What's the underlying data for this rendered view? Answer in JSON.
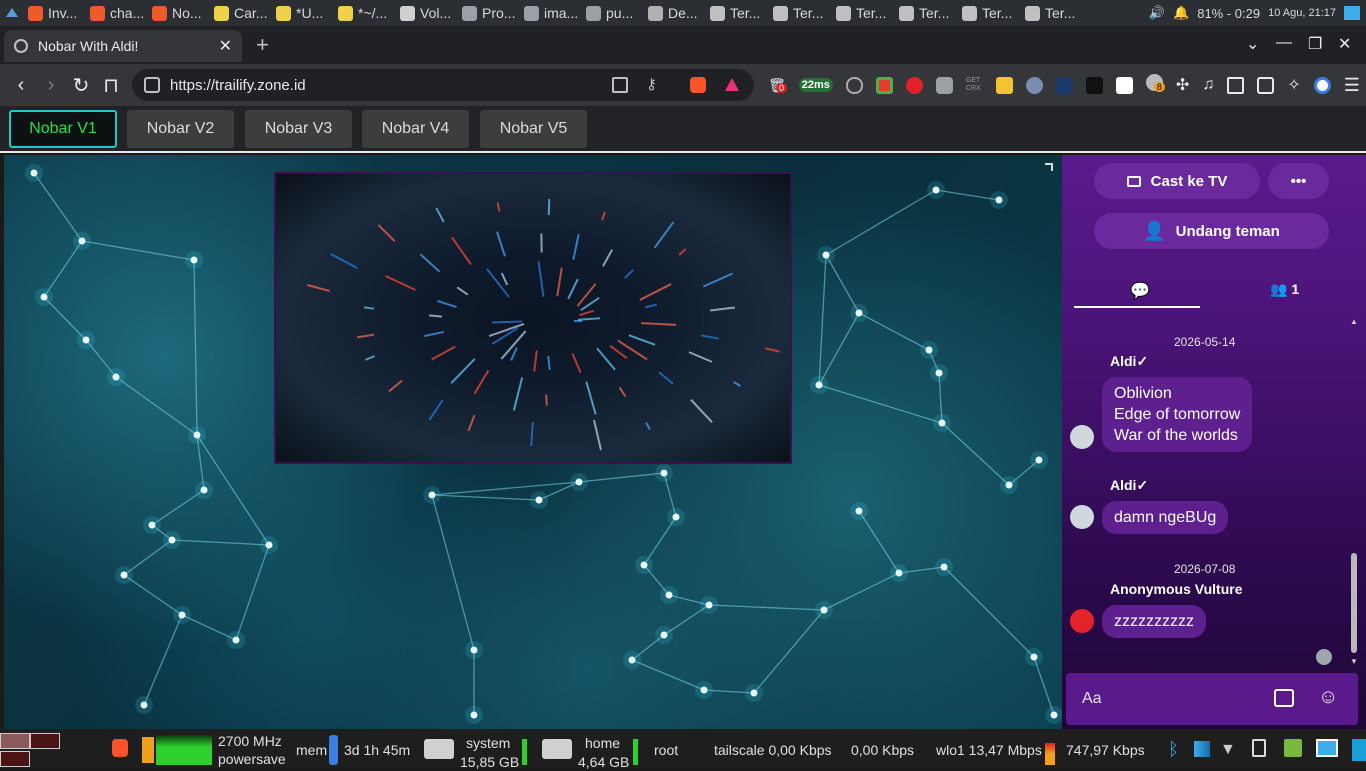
{
  "taskbar": {
    "items": [
      {
        "label": "Inv...",
        "color": "#ef5a2a"
      },
      {
        "label": "cha...",
        "color": "#ef5a2a"
      },
      {
        "label": "No...",
        "color": "#ef5a2a"
      },
      {
        "label": "Car...",
        "color": "#f0d24a"
      },
      {
        "label": "*U...",
        "color": "#f0d24a"
      },
      {
        "label": "*~/...",
        "color": "#f0d24a"
      },
      {
        "label": "Vol...",
        "color": "#d0d0d0"
      },
      {
        "label": "Pro...",
        "color": "#9aa0a6"
      },
      {
        "label": "ima...",
        "color": "#9aa0a6"
      },
      {
        "label": "pu...",
        "color": "#9aa0a6"
      },
      {
        "label": "De...",
        "color": "#b0b0b0"
      },
      {
        "label": "Ter...",
        "color": "#c0c0c0"
      },
      {
        "label": "Ter...",
        "color": "#c0c0c0"
      },
      {
        "label": "Ter...",
        "color": "#c0c0c0"
      },
      {
        "label": "Ter...",
        "color": "#c0c0c0"
      },
      {
        "label": "Ter...",
        "color": "#c0c0c0"
      },
      {
        "label": "Ter...",
        "color": "#c0c0c0"
      }
    ],
    "battery": "81% - 0:29",
    "date": "10 Agu, 21:17"
  },
  "browser": {
    "tab_title": "Nobar With Aldi!",
    "url": "https://trailify.zone.id",
    "ext_badges": {
      "first": "0",
      "latency": "22ms",
      "counter": "8"
    },
    "ext_labels": {
      "getcrx": "GET CRX"
    }
  },
  "site_nav": {
    "buttons": [
      {
        "label": "Nobar V1"
      },
      {
        "label": "Nobar V2"
      },
      {
        "label": "Nobar V3"
      },
      {
        "label": "Nobar V4"
      },
      {
        "label": "Nobar V5"
      }
    ]
  },
  "chat": {
    "cast_label": "Cast ke TV",
    "more_label": "•••",
    "invite_label": "Undang teman",
    "members_count": "1",
    "input_placeholder": "Aa",
    "messages": [
      {
        "date": "2026-05-14",
        "user": "Aldi✓",
        "lines": [
          "Oblivion",
          "Edge of tomorrow",
          "War of the worlds"
        ]
      },
      {
        "date": "",
        "user": "Aldi✓",
        "lines": [
          "damn ngeBUg"
        ]
      },
      {
        "date": "2026-07-08",
        "user": "Anonymous Vulture",
        "lines": [
          "zzzzzzzzzz"
        ]
      }
    ]
  },
  "bottom_panel": {
    "cpu_freq": "2700 MHz",
    "governor": "powersave",
    "mem_label": "mem",
    "uptime": "3d 1h 45m",
    "disk_system_label": "system",
    "disk_system_size": "15,85 GB",
    "disk_home_label": "home",
    "disk_home_size": "4,64 GB",
    "root_label": "root",
    "tailscale": "tailscale 0,00 Kbps",
    "tailscale_up": "0,00 Kbps",
    "wlo1": "wlo1 13,47 Mbps",
    "wlo1_up": "747,97 Kbps"
  }
}
